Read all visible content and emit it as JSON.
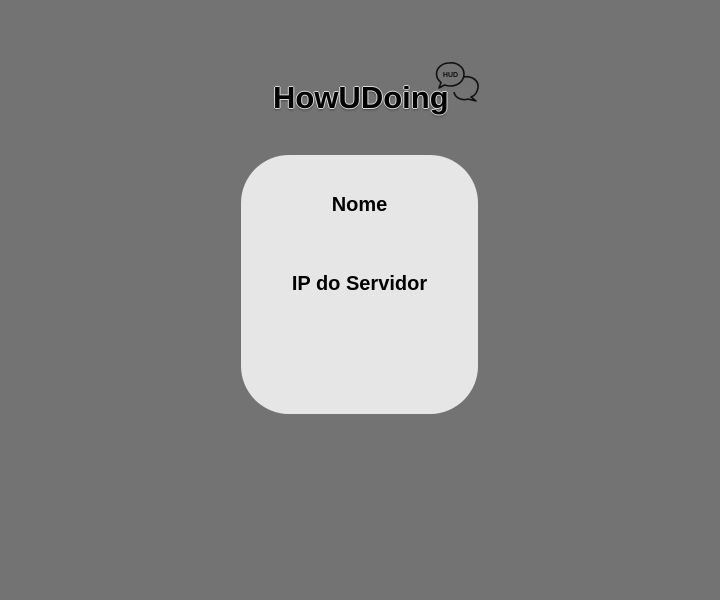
{
  "app": {
    "name": "HowUDoing",
    "logo_badge": "HUD"
  },
  "form": {
    "name_label": "Nome",
    "name_value": "",
    "server_ip_label": "IP do Servidor",
    "server_ip_value": ""
  },
  "colors": {
    "background": "#737373",
    "card": "#e6e6e6",
    "text": "#000000"
  },
  "icons": {
    "logo_icon": "chat-bubbles-icon"
  }
}
